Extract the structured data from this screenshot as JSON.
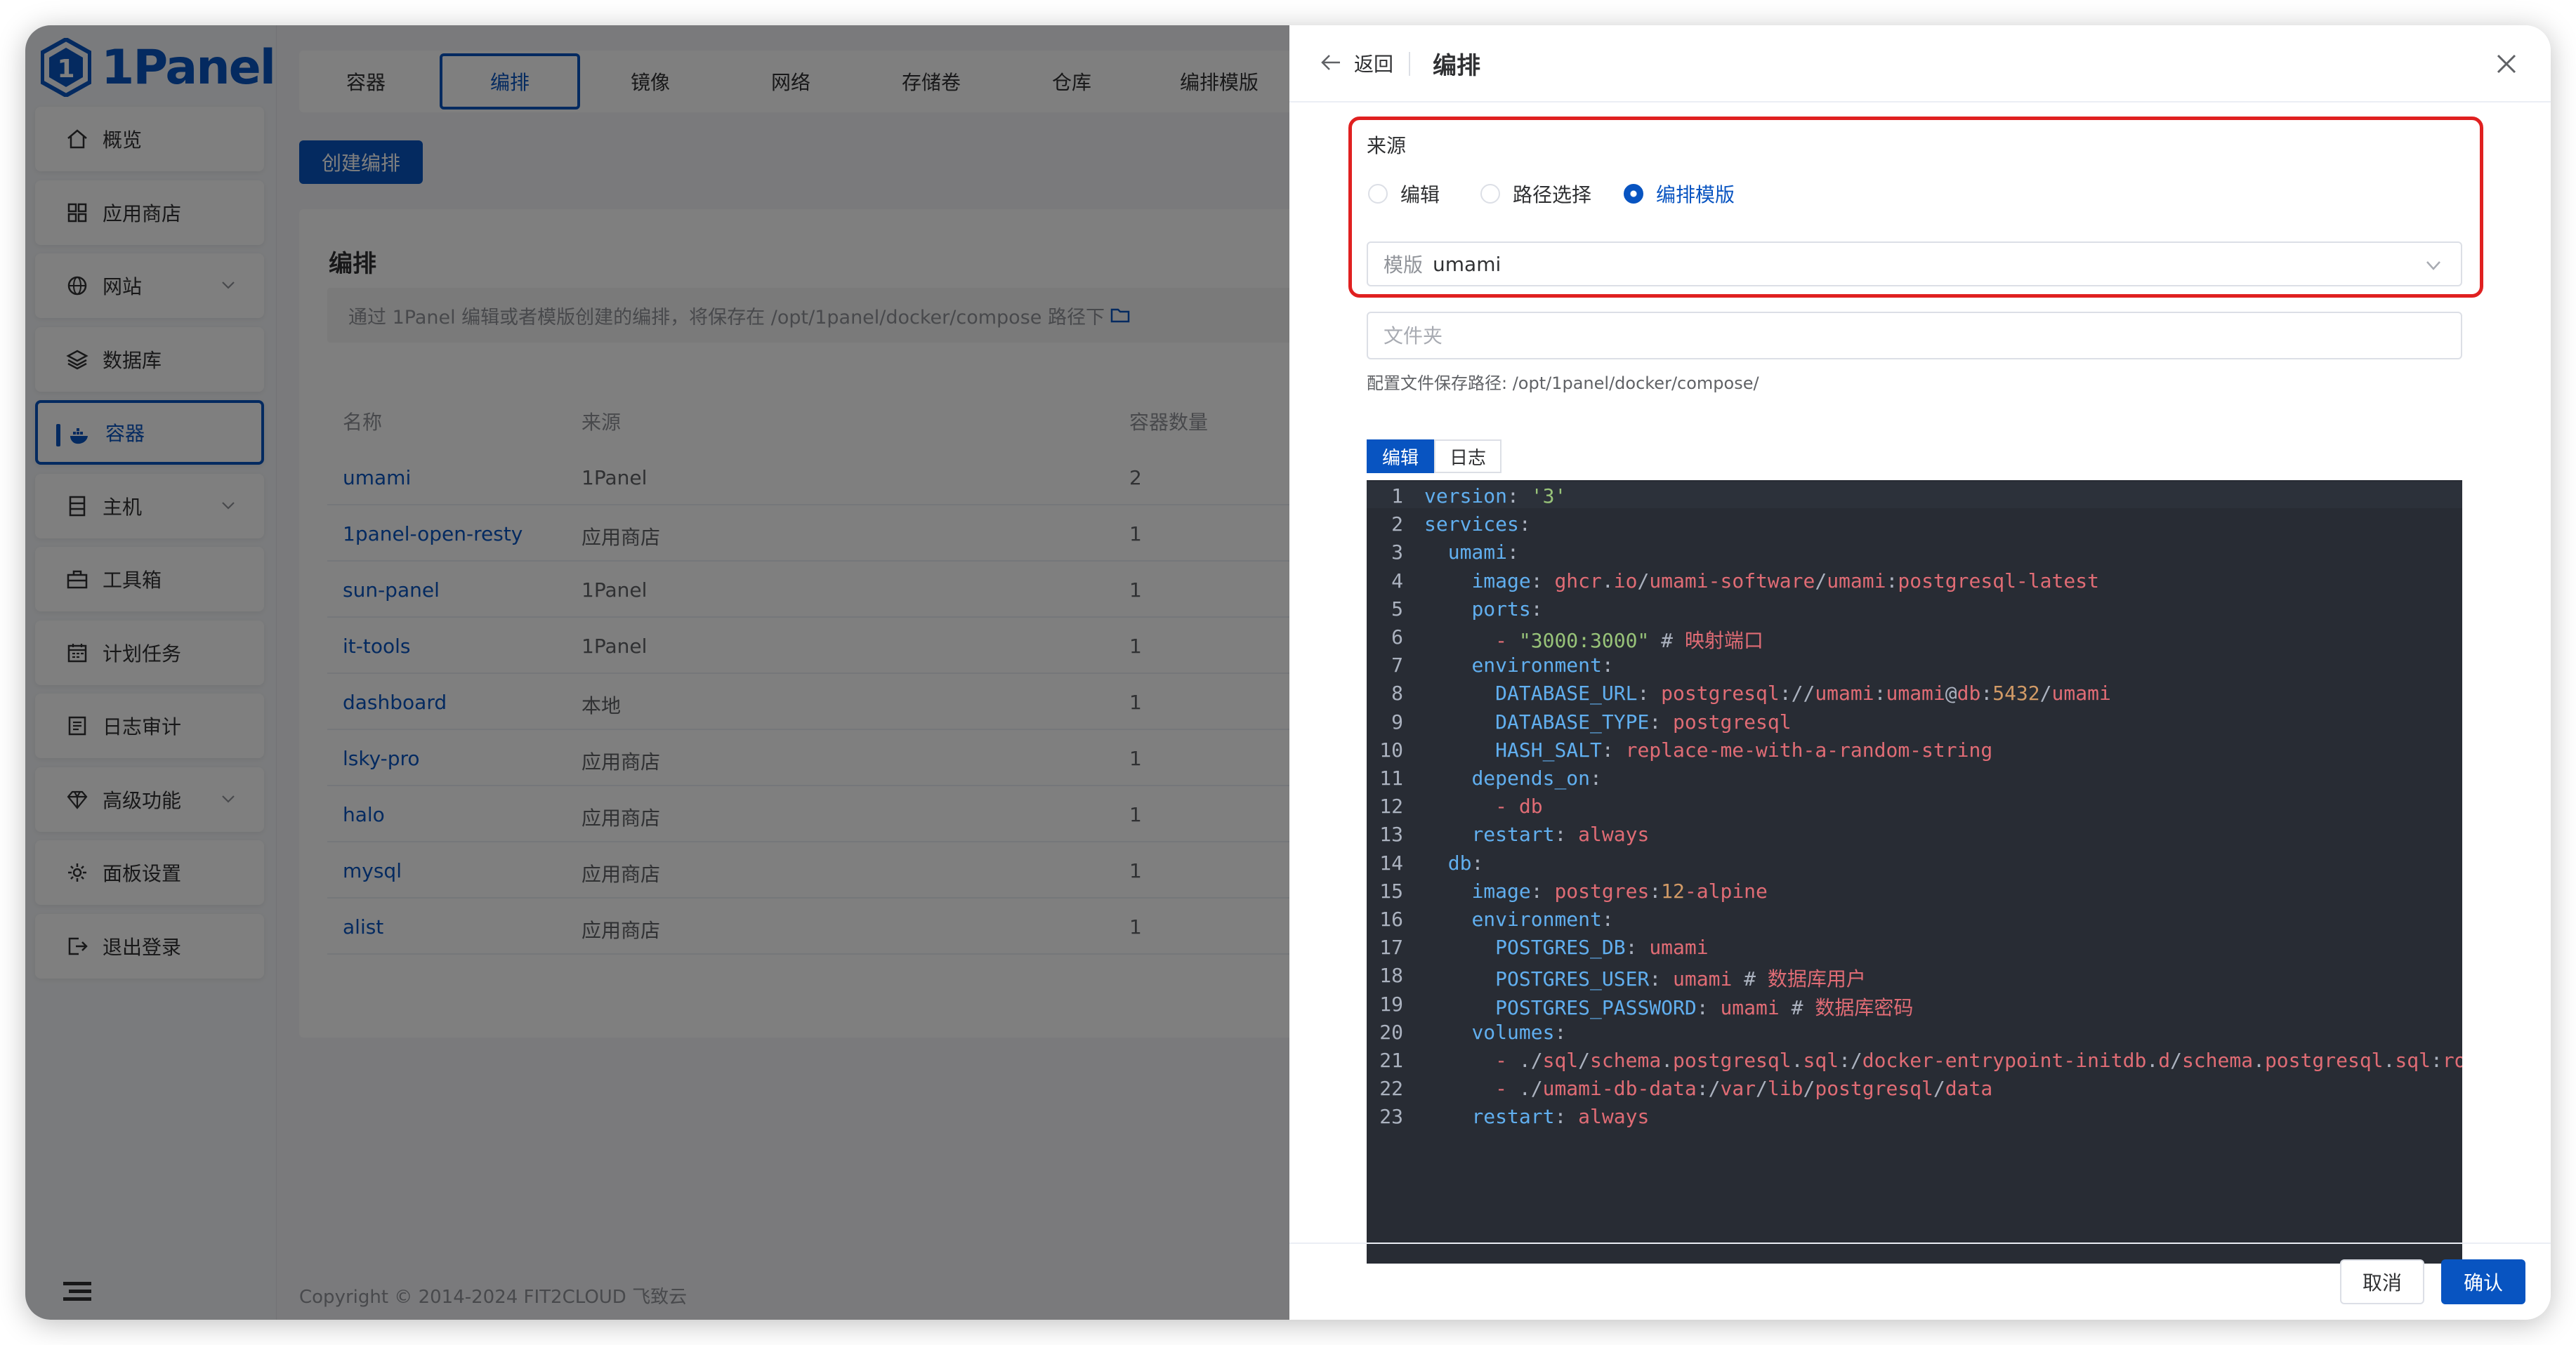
{
  "app": {
    "logo_text": "1Panel"
  },
  "sidebar": {
    "items": [
      {
        "label": "概览",
        "icon": "home-icon"
      },
      {
        "label": "应用商店",
        "icon": "grid-icon"
      },
      {
        "label": "网站",
        "icon": "globe-icon",
        "has_sub": true
      },
      {
        "label": "数据库",
        "icon": "layers-icon"
      },
      {
        "label": "容器",
        "icon": "docker-icon",
        "active": true
      },
      {
        "label": "主机",
        "icon": "server-icon",
        "has_sub": true
      },
      {
        "label": "工具箱",
        "icon": "toolbox-icon"
      },
      {
        "label": "计划任务",
        "icon": "calendar-icon"
      },
      {
        "label": "日志审计",
        "icon": "log-icon"
      },
      {
        "label": "高级功能",
        "icon": "diamond-icon",
        "has_sub": true
      },
      {
        "label": "面板设置",
        "icon": "gear-icon"
      },
      {
        "label": "退出登录",
        "icon": "logout-icon"
      }
    ]
  },
  "tabs": [
    "容器",
    "编排",
    "镜像",
    "网络",
    "存储卷",
    "仓库",
    "编排模版"
  ],
  "active_tab": "编排",
  "create_button": "创建编排",
  "compose_card": {
    "title": "编排",
    "description": "通过 1Panel 编辑或者模版创建的编排，将保存在 /opt/1panel/docker/compose 路径下",
    "columns": [
      "名称",
      "来源",
      "容器数量"
    ],
    "rows": [
      {
        "name": "umami",
        "source": "1Panel",
        "count": "2"
      },
      {
        "name": "1panel-open-resty",
        "source": "应用商店",
        "count": "1"
      },
      {
        "name": "sun-panel",
        "source": "1Panel",
        "count": "1"
      },
      {
        "name": "it-tools",
        "source": "1Panel",
        "count": "1"
      },
      {
        "name": "dashboard",
        "source": "本地",
        "count": "1"
      },
      {
        "name": "lsky-pro",
        "source": "应用商店",
        "count": "1"
      },
      {
        "name": "halo",
        "source": "应用商店",
        "count": "1"
      },
      {
        "name": "mysql",
        "source": "应用商店",
        "count": "1"
      },
      {
        "name": "alist",
        "source": "应用商店",
        "count": "1"
      }
    ]
  },
  "footer": {
    "copyright": "Copyright © 2014-2024 FIT2CLOUD 飞致云"
  },
  "drawer": {
    "back_label": "返回",
    "title": "编排",
    "source_label": "来源",
    "source_options": [
      "编辑",
      "路径选择",
      "编排模版"
    ],
    "source_selected": "编排模版",
    "template_prefix": "模版",
    "template_value": "umami",
    "folder_placeholder": "文件夹",
    "path_hint": "配置文件保存路径: /opt/1panel/docker/compose/",
    "editor_tabs": [
      "编辑",
      "日志"
    ],
    "editor_active_tab": "编辑",
    "cancel_label": "取消",
    "confirm_label": "确认",
    "code_lines": [
      "version: '3'",
      "services:",
      "  umami:",
      "    image: ghcr.io/umami-software/umami:postgresql-latest",
      "    ports:",
      "      - \"3000:3000\" # 映射端口",
      "    environment:",
      "      DATABASE_URL: postgresql://umami:umami@db:5432/umami",
      "      DATABASE_TYPE: postgresql",
      "      HASH_SALT: replace-me-with-a-random-string",
      "    depends_on:",
      "      - db",
      "    restart: always",
      "  db:",
      "    image: postgres:12-alpine",
      "    environment:",
      "      POSTGRES_DB: umami",
      "      POSTGRES_USER: umami # 数据库用户",
      "      POSTGRES_PASSWORD: umami # 数据库密码",
      "    volumes:",
      "      - ./sql/schema.postgresql.sql:/docker-entrypoint-initdb.d/schema.postgresql.sql:ro",
      "      - ./umami-db-data:/var/lib/postgresql/data",
      "    restart: always"
    ]
  },
  "colors": {
    "primary": "#0854c1",
    "highlight_border": "#e02020",
    "editor_bg": "#282c34"
  }
}
